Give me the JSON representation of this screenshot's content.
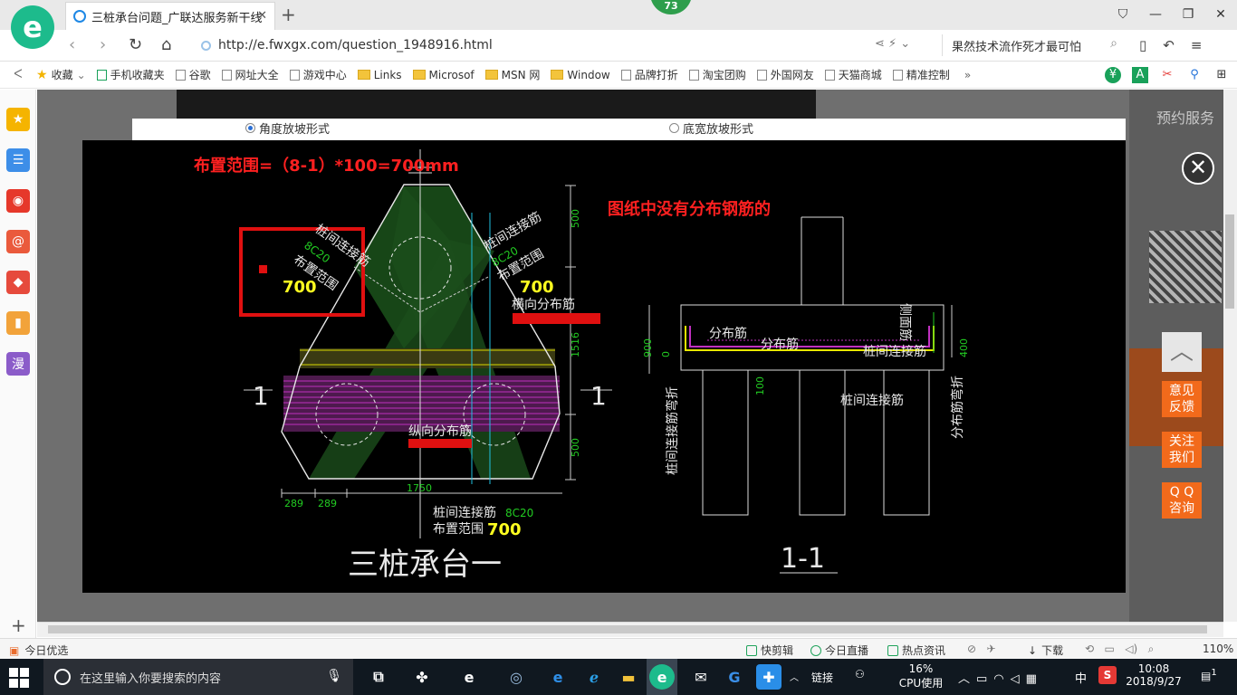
{
  "browser": {
    "logo": "e",
    "tab": {
      "title": "三桩承台问题_广联达服务新干线",
      "close": "✕"
    },
    "new_tab": "+",
    "badge": "73",
    "window_buttons": [
      "⛉",
      "—",
      "❐",
      "✕"
    ]
  },
  "address": {
    "url": "http://e.fwxgx.com/question_1948916.html",
    "search_text": "果然技术流作死才最可怕"
  },
  "bookmarks": {
    "collapse": "ᐸ",
    "items": [
      {
        "label": "收藏",
        "icon": "star-icon"
      },
      {
        "label": "手机收藏夹",
        "icon": "phone-icon"
      },
      {
        "label": "谷歌",
        "icon": "page-icon"
      },
      {
        "label": "网址大全",
        "icon": "page-icon"
      },
      {
        "label": "游戏中心",
        "icon": "page-icon"
      },
      {
        "label": "Links",
        "icon": "folder-icon"
      },
      {
        "label": "Microsof",
        "icon": "folder-icon"
      },
      {
        "label": "MSN 网",
        "icon": "folder-icon"
      },
      {
        "label": "Window",
        "icon": "folder-icon"
      },
      {
        "label": "品牌打折",
        "icon": "page-icon"
      },
      {
        "label": "淘宝团购",
        "icon": "page-icon"
      },
      {
        "label": "外国网友",
        "icon": "page-icon"
      },
      {
        "label": "天猫商城",
        "icon": "page-icon"
      },
      {
        "label": "精准控制",
        "icon": "page-icon"
      }
    ],
    "more": "»"
  },
  "sidebar": {
    "items": [
      {
        "name": "favorites",
        "glyph": "★",
        "color": "#f5b400"
      },
      {
        "name": "news",
        "glyph": "☰",
        "color": "#3d8ee8"
      },
      {
        "name": "weibo",
        "glyph": "◉",
        "color": "#e6382b"
      },
      {
        "name": "mail",
        "glyph": "@",
        "color": "#ea5a3c"
      },
      {
        "name": "game",
        "glyph": "◆",
        "color": "#e64a3c"
      },
      {
        "name": "novel",
        "glyph": "▮",
        "color": "#f2a33a"
      },
      {
        "name": "comic",
        "glyph": "漫",
        "color": "#8b5cc9"
      }
    ],
    "add": "+"
  },
  "page": {
    "modal": {
      "option_angle": "角度放坡形式",
      "option_width": "底宽放坡形式",
      "close": "✕"
    },
    "right_panel": {
      "service": "预约服务"
    },
    "float_buttons": {
      "top": "︿",
      "feedback": [
        "意见",
        "反馈"
      ],
      "follow": [
        "关注",
        "我们"
      ],
      "qq": [
        "Q Q",
        "咨询"
      ]
    }
  },
  "drawing": {
    "annotation_range": "布置范围=（8-1）*100=700mm",
    "annotation_note": "图纸中没有分布钢筋的",
    "pile_connect_bar": "桩间连接筋",
    "spec_8c20": "8C20",
    "layout_range": "布置范围",
    "value_700": "700",
    "horizontal_bar": "横向分布筋",
    "longitudinal_bar": "纵向分布筋",
    "dim_500": "500",
    "dim_1516": "1516",
    "dim_1750": "1750",
    "dim_289": "289",
    "section_mark": "1",
    "title_main": "三桩承台一",
    "title_section": "1-1",
    "distribution_bar": "分布筋",
    "side_bar": "侧面筋",
    "dim_900": "900",
    "dim_0": "0",
    "dim_100": "100",
    "dim_400": "400",
    "bend_pile": "桩间连接筋弯折",
    "bend_dist": "分布筋弯折"
  },
  "statusbar": {
    "left": "今日优选",
    "items": [
      "快剪辑",
      "今日直播",
      "热点资讯"
    ],
    "download": "下载",
    "zoom": "110%"
  },
  "taskbar": {
    "search_placeholder": "在这里输入你要搜索的内容",
    "link": "链接",
    "cpu_percent": "16%",
    "cpu_label": "CPU使用",
    "ime": "中",
    "time": "10:08",
    "date": "2018/9/27",
    "notifications": "1"
  }
}
